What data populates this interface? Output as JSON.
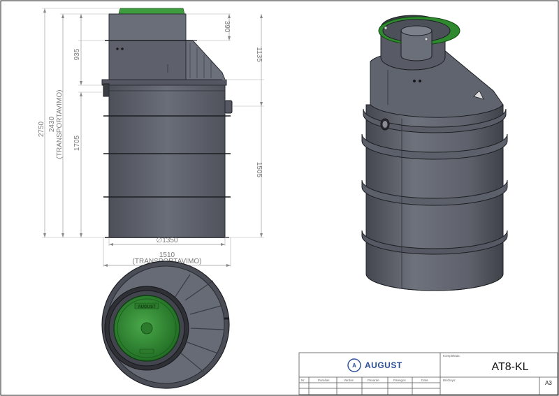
{
  "dimensions": {
    "d2750": "2750",
    "d2430": "2430",
    "d2430_note": "(TRANSPORTAVIMO)",
    "d935": "935",
    "d1705": "1705",
    "d390": "390",
    "d1135": "1135",
    "d1505": "1505",
    "d1350": "∅1350",
    "d1510": "1510",
    "d1510_note": "(TRANSPORTAVIMO)"
  },
  "lid_brand": "AUGUST",
  "title_block": {
    "brand": "AUGUST",
    "komplektas_label": "Komplektas:",
    "model": "AT8-KL",
    "brezinys_label": "Brėžinys:",
    "sheet_size": "A3",
    "col_nr": "Nr.",
    "col_parasas": "Parašas",
    "col_vardas": "Vardas",
    "col_pavarde": "Pavardė",
    "col_pareigos": "Pareigos",
    "col_data": "Data"
  },
  "colors": {
    "tank_body": "#5f6370",
    "tank_dark": "#3d4049",
    "lid_green": "#3b9a3b",
    "brand_blue": "#2b4f9a"
  }
}
